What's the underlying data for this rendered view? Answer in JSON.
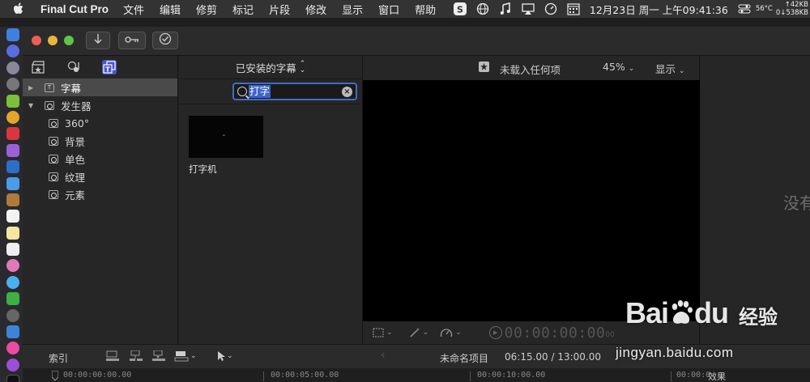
{
  "menubar": {
    "app_name": "Final Cut Pro",
    "menus": [
      "文件",
      "编辑",
      "修剪",
      "标记",
      "片段",
      "修改",
      "显示",
      "窗口",
      "帮助"
    ],
    "clock": "12月23日 周一 上午09:41:36",
    "temperature": "56°C",
    "net_up": "↑42KB",
    "net_down": "0↓538KB",
    "status_icons": [
      "sougou-icon",
      "globe-icon",
      "music-icon",
      "airplay-icon",
      "speedometer-icon",
      "calendar-icon",
      "control-center-icon",
      "battery-icon"
    ]
  },
  "toolbar": {
    "import_icon": "download-arrow-icon",
    "keyword_icon": "key-icon",
    "background_tasks_icon": "checkmark-circle-icon"
  },
  "libraries": {
    "header_icons": [
      "clapper-star-icon",
      "music-photos-icon",
      "titles-generators-icon"
    ],
    "tree": [
      {
        "label": "字幕",
        "level": 0,
        "expanded": false,
        "selected": true,
        "icon": "text-box-icon"
      },
      {
        "label": "发生器",
        "level": 0,
        "expanded": true,
        "selected": false,
        "icon": "generator-icon"
      },
      {
        "label": "360°",
        "level": 1,
        "selected": false,
        "icon": "generator-icon"
      },
      {
        "label": "背景",
        "level": 1,
        "selected": false,
        "icon": "generator-icon"
      },
      {
        "label": "单色",
        "level": 1,
        "selected": false,
        "icon": "generator-icon"
      },
      {
        "label": "纹理",
        "level": 1,
        "selected": false,
        "icon": "generator-icon"
      },
      {
        "label": "元素",
        "level": 1,
        "selected": false,
        "icon": "generator-icon"
      }
    ]
  },
  "browser": {
    "dropdown_label": "已安装的字幕",
    "search_value": "打字",
    "results": [
      {
        "label": "打字机"
      }
    ]
  },
  "viewer": {
    "title": "未载入任何项",
    "zoom": "45%",
    "view_menu": "显示",
    "timecode": "00:00:00:00",
    "timecode_frames": "00"
  },
  "inspector": {
    "empty_text": "没有"
  },
  "timeline": {
    "index_label": "索引",
    "project_name": "未命名项目",
    "duration": "06:15.00 / 13:00.00",
    "ruler_ticks": [
      "00:00:00:00.00",
      "00:00:05:00.00",
      "00:00:10:00.00",
      "00:00:0"
    ],
    "effects_label": "效果"
  },
  "watermark": {
    "brand": "Bai",
    "brand_paw": "du",
    "cn": "经验",
    "url": "jingyan.baidu.com"
  },
  "colors": {
    "accent": "#4b53c9",
    "search_border": "#3f6dc8",
    "selection": "#3e64c8"
  }
}
